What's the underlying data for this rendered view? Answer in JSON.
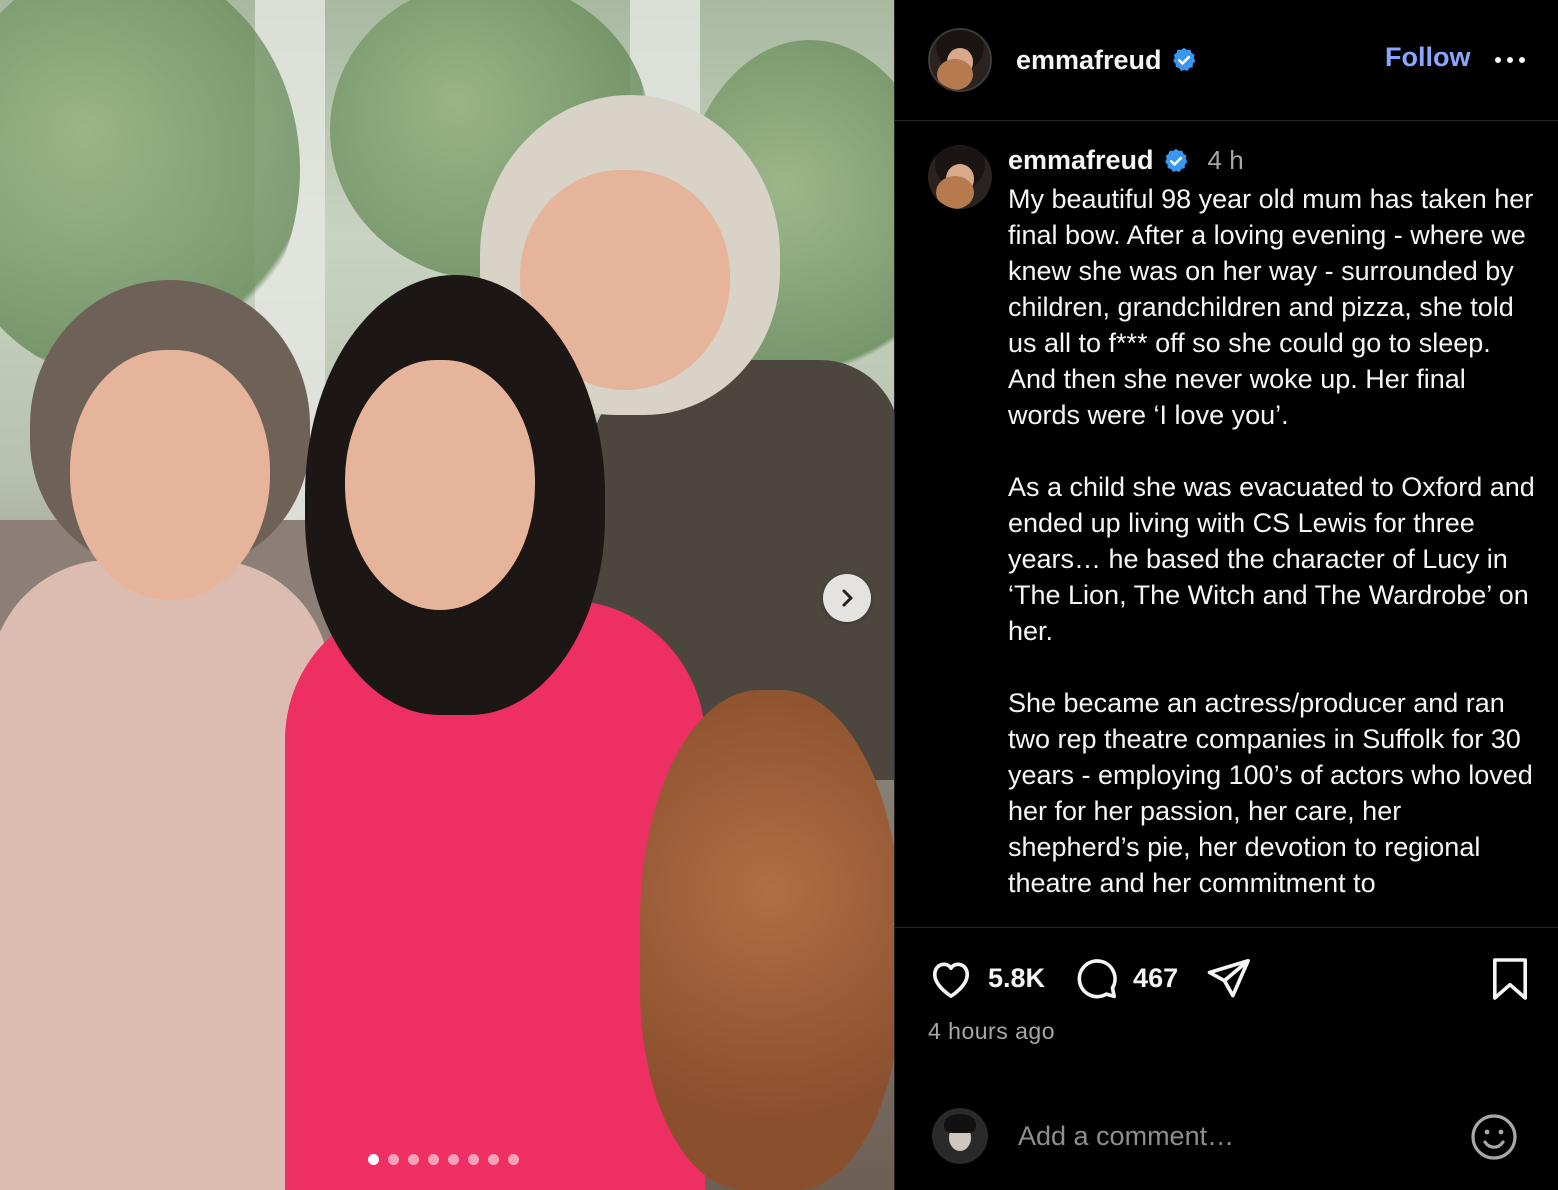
{
  "post": {
    "carousel_dots": 8,
    "active_dot": 0
  },
  "header": {
    "username": "emmafreud",
    "follow_label": "Follow"
  },
  "caption": {
    "username": "emmafreud",
    "time": "4 h",
    "text": "My beautiful 98 year old mum has taken her final bow. After a loving evening - where we knew she was on her way - surrounded by children, grandchildren and pizza, she told us all to f*** off so she could go to sleep.  And then she never woke up. Her final words were ‘I love you’.\n\nAs a child she was evacuated to Oxford and ended up living with CS Lewis for three years… he based the character of Lucy in ‘The Lion, The Witch and The Wardrobe’ on her.\n\nShe became an actress/producer and ran two rep theatre companies in Suffolk for 30 years - employing 100’s of actors who loved her for her passion, her care, her shepherd’s pie, her devotion to regional theatre and her commitment to"
  },
  "actions": {
    "likes": "5.8K",
    "comments": "467",
    "posted_ago": "4 hours ago"
  },
  "comment_box": {
    "placeholder": "Add a comment…"
  },
  "colors": {
    "background": "#000000",
    "follow_blue": "#8aa6ff",
    "verified_blue": "#3897f0",
    "muted_text": "#a8a8a8"
  },
  "icons": [
    "verified-badge-icon",
    "more-options-icon",
    "heart-icon",
    "comment-icon",
    "share-icon",
    "bookmark-icon",
    "emoji-icon",
    "chevron-right-icon"
  ]
}
